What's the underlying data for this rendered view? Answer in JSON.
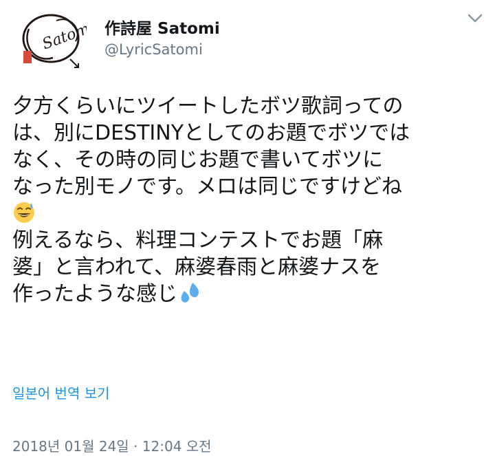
{
  "profile": {
    "display_name": "作詩屋 Satomi",
    "handle": "@LyricSatomi",
    "avatar_text": "Satomi"
  },
  "menu": {
    "icon": "chevron-down-icon"
  },
  "tweet": {
    "lines": [
      "夕方くらいにツイートしたボツ歌詞っての",
      "は、別にDESTINYとしてのお題でボツでは",
      "なく、その時の同じお題で書いてボツに",
      "なった別モノです。メロは同じですけどね",
      "例えるなら、料理コンテストでお題「麻",
      "婆」と言われて、麻婆春雨と麻婆ナスを",
      "作ったような感じ"
    ],
    "emoji_1": "smiling-face-with-sweat-emoji",
    "emoji_2": "sweat-droplets-emoji"
  },
  "translate_link": "일본어 번역 보기",
  "timestamp": "2018년 01월 24일 · 12:04 오전",
  "colors": {
    "link": "#1b95e0",
    "secondary_text": "#657786",
    "primary_text": "#14171a"
  }
}
